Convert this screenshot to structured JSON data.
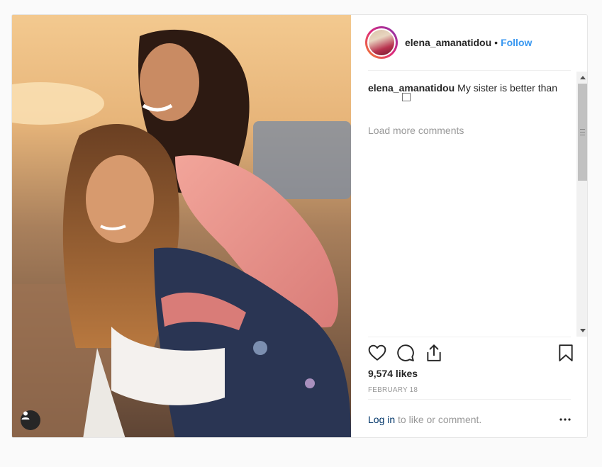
{
  "post": {
    "username": "elena_amanatidou",
    "separator": "•",
    "follow_label": "Follow",
    "caption_username": "elena_amanatidou",
    "caption_text": "My sister is better than",
    "load_more": "Load more comments",
    "likes": "9,574 likes",
    "date": "FEBRUARY 18",
    "login_link": "Log in",
    "login_text": " to like or comment."
  },
  "icons": {
    "like": "heart-icon",
    "comment": "comment-icon",
    "share": "share-icon",
    "save": "bookmark-icon",
    "more": "more-dots-icon",
    "user_tag": "user-icon"
  },
  "colors": {
    "link": "#3897f0",
    "text": "#262626",
    "muted": "#999999"
  }
}
